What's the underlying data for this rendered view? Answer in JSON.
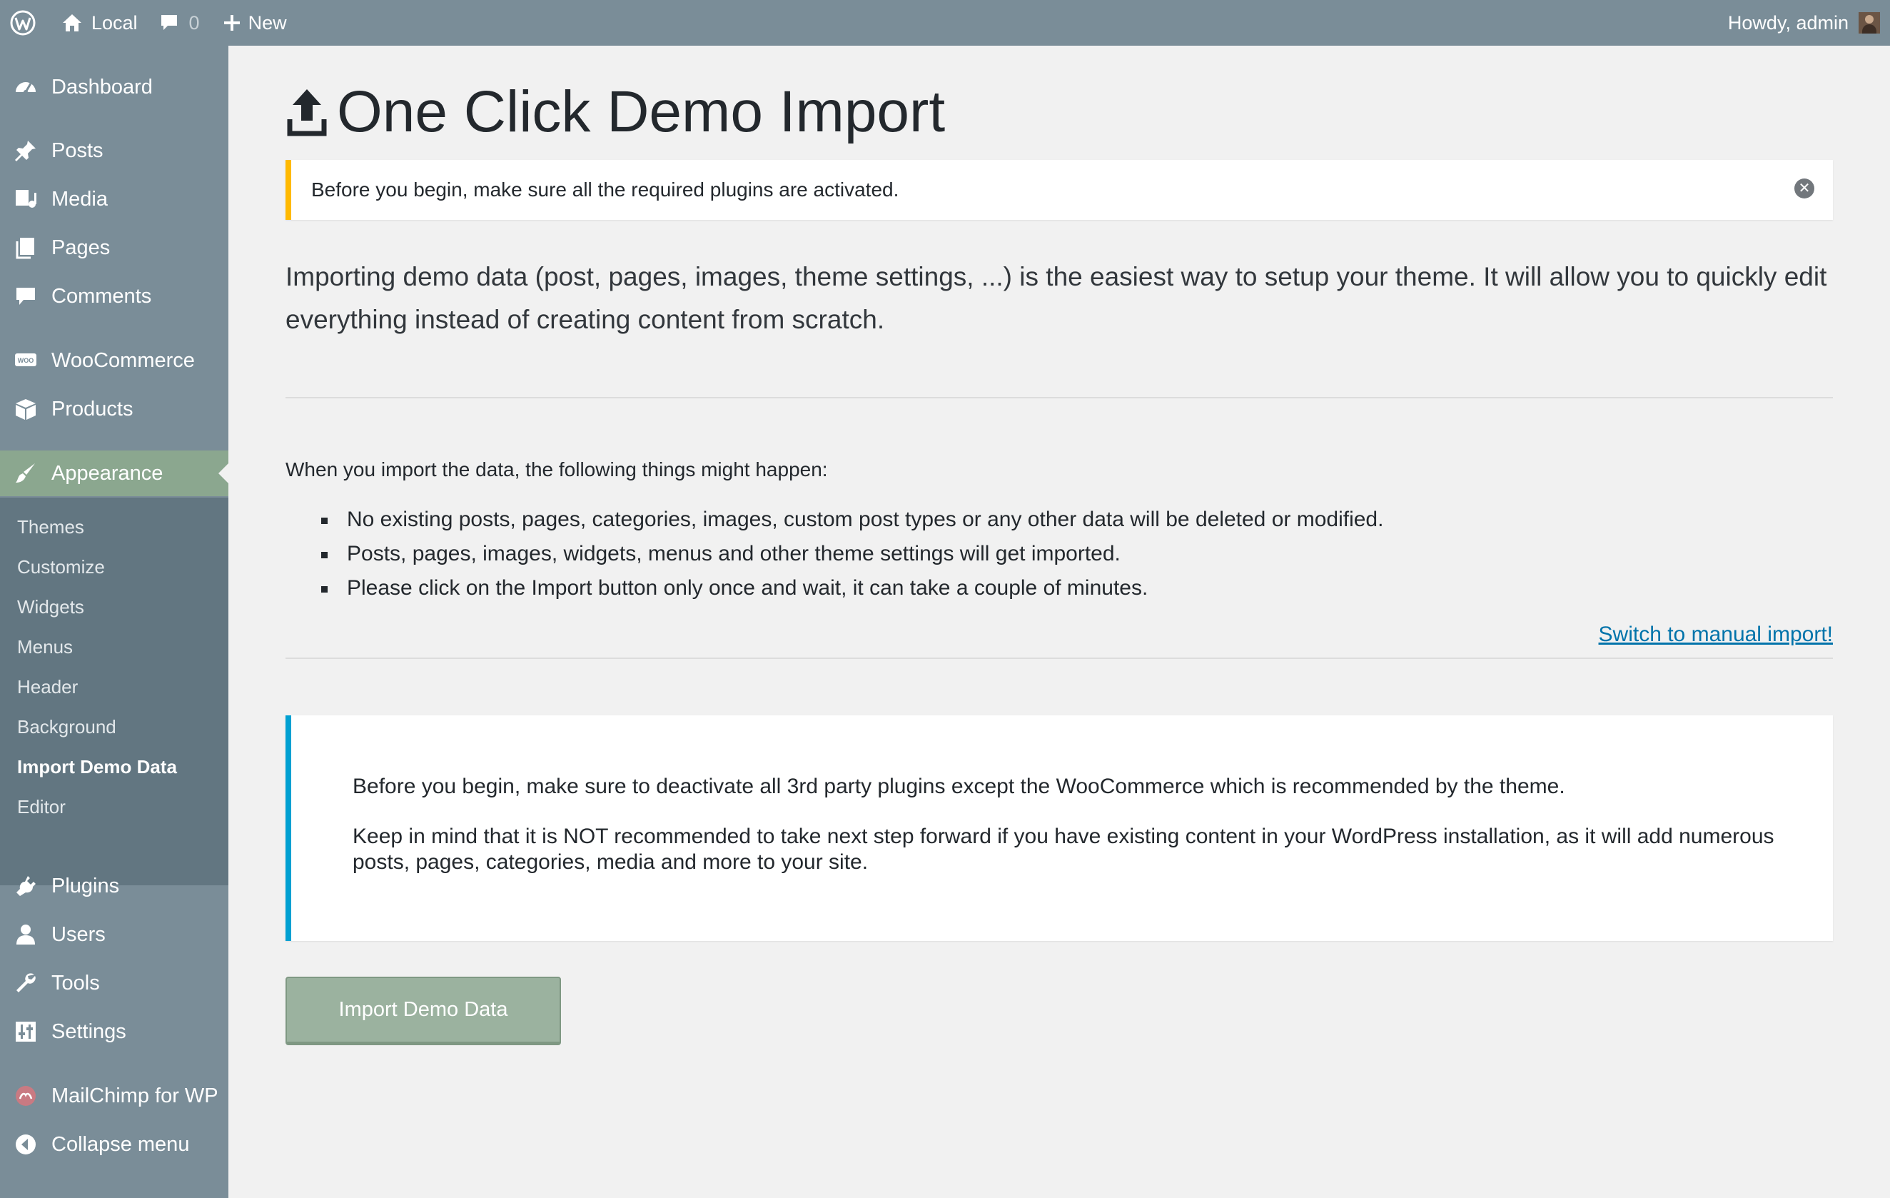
{
  "admin_bar": {
    "site_name": "Local",
    "comment_count": "0",
    "new_label": "New",
    "greeting": "Howdy, admin"
  },
  "sidebar": {
    "items": [
      {
        "label": "Dashboard",
        "icon": "dashboard-icon"
      },
      {
        "label": "Posts",
        "icon": "pin-icon"
      },
      {
        "label": "Media",
        "icon": "media-icon"
      },
      {
        "label": "Pages",
        "icon": "pages-icon"
      },
      {
        "label": "Comments",
        "icon": "comment-icon"
      },
      {
        "label": "WooCommerce",
        "icon": "woocommerce-icon"
      },
      {
        "label": "Products",
        "icon": "box-icon"
      },
      {
        "label": "Appearance",
        "icon": "paintbrush-icon"
      },
      {
        "label": "Plugins",
        "icon": "plug-icon"
      },
      {
        "label": "Users",
        "icon": "user-icon"
      },
      {
        "label": "Tools",
        "icon": "wrench-icon"
      },
      {
        "label": "Settings",
        "icon": "sliders-icon"
      },
      {
        "label": "MailChimp for WP",
        "icon": "mailchimp-icon"
      },
      {
        "label": "Collapse menu",
        "icon": "collapse-icon"
      }
    ],
    "submenu": [
      "Themes",
      "Customize",
      "Widgets",
      "Menus",
      "Header",
      "Background",
      "Import Demo Data",
      "Editor"
    ]
  },
  "page": {
    "title": "One Click Demo Import",
    "warning_notice": "Before you begin, make sure all the required plugins are activated.",
    "intro": "Importing demo data (post, pages, images, theme settings, ...) is the easiest way to setup your theme. It will allow you to quickly edit everything instead of creating content from scratch.",
    "things_title": "When you import the data, the following things might happen:",
    "things": [
      "No existing posts, pages, categories, images, custom post types or any other data will be deleted or modified.",
      "Posts, pages, images, widgets, menus and other theme settings will get imported.",
      "Please click on the Import button only once and wait, it can take a couple of minutes."
    ],
    "manual_link": "Switch to manual import!",
    "info_p1": "Before you begin, make sure to deactivate all 3rd party plugins except the WooCommerce which is recommended by the theme.",
    "info_p2": "Keep in mind that it is NOT recommended to take next step forward if you have existing content in your WordPress installation, as it will add numerous posts, pages, categories, media and more to your site.",
    "import_button": "Import Demo Data"
  },
  "colors": {
    "admin_bar": "#7a8d98",
    "sidebar": "#7a8d98",
    "submenu": "#627681",
    "active_menu": "#8ba78f",
    "warning_border": "#ffb900",
    "info_border": "#00a0d2",
    "link": "#0073aa",
    "button": "#9bb29f"
  }
}
